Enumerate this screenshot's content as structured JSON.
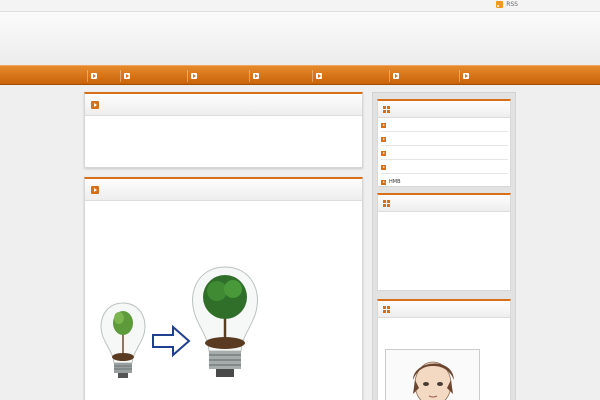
{
  "topbar": {
    "rss_label": "RSS"
  },
  "header": {
    "title": "",
    "description": ""
  },
  "nav": {
    "items": [
      {
        "label": ""
      },
      {
        "label": ""
      },
      {
        "label": ""
      },
      {
        "label": ""
      },
      {
        "label": ""
      },
      {
        "label": ""
      },
      {
        "label": ""
      }
    ]
  },
  "posts": [
    {
      "title": "",
      "lines": [
        "",
        ""
      ]
    },
    {
      "title": "",
      "lines": [
        "",
        "",
        ""
      ]
    }
  ],
  "sidebar": {
    "widgets": [
      {
        "title": "",
        "items": [
          {
            "label": ""
          },
          {
            "label": ""
          },
          {
            "label": ""
          },
          {
            "label": ""
          },
          {
            "label": "HMB"
          }
        ]
      },
      {
        "title": "",
        "items": [
          {
            "label": ""
          },
          {
            "label": ""
          },
          {
            "label": ""
          },
          {
            "label": ""
          },
          {
            "label": ""
          },
          {
            "label": ""
          }
        ]
      },
      {
        "title": "",
        "lines": [
          "",
          "",
          ""
        ]
      }
    ]
  },
  "colors": {
    "accent": "#d8701a",
    "nav_top": "#e78a2c",
    "nav_bottom": "#c9620a",
    "link": "#1d5ba8"
  },
  "icons": {
    "rss": "rss-icon",
    "nav": "arrow-box-icon",
    "post_title": "arrow-box-icon",
    "widget": "grid-icon"
  }
}
